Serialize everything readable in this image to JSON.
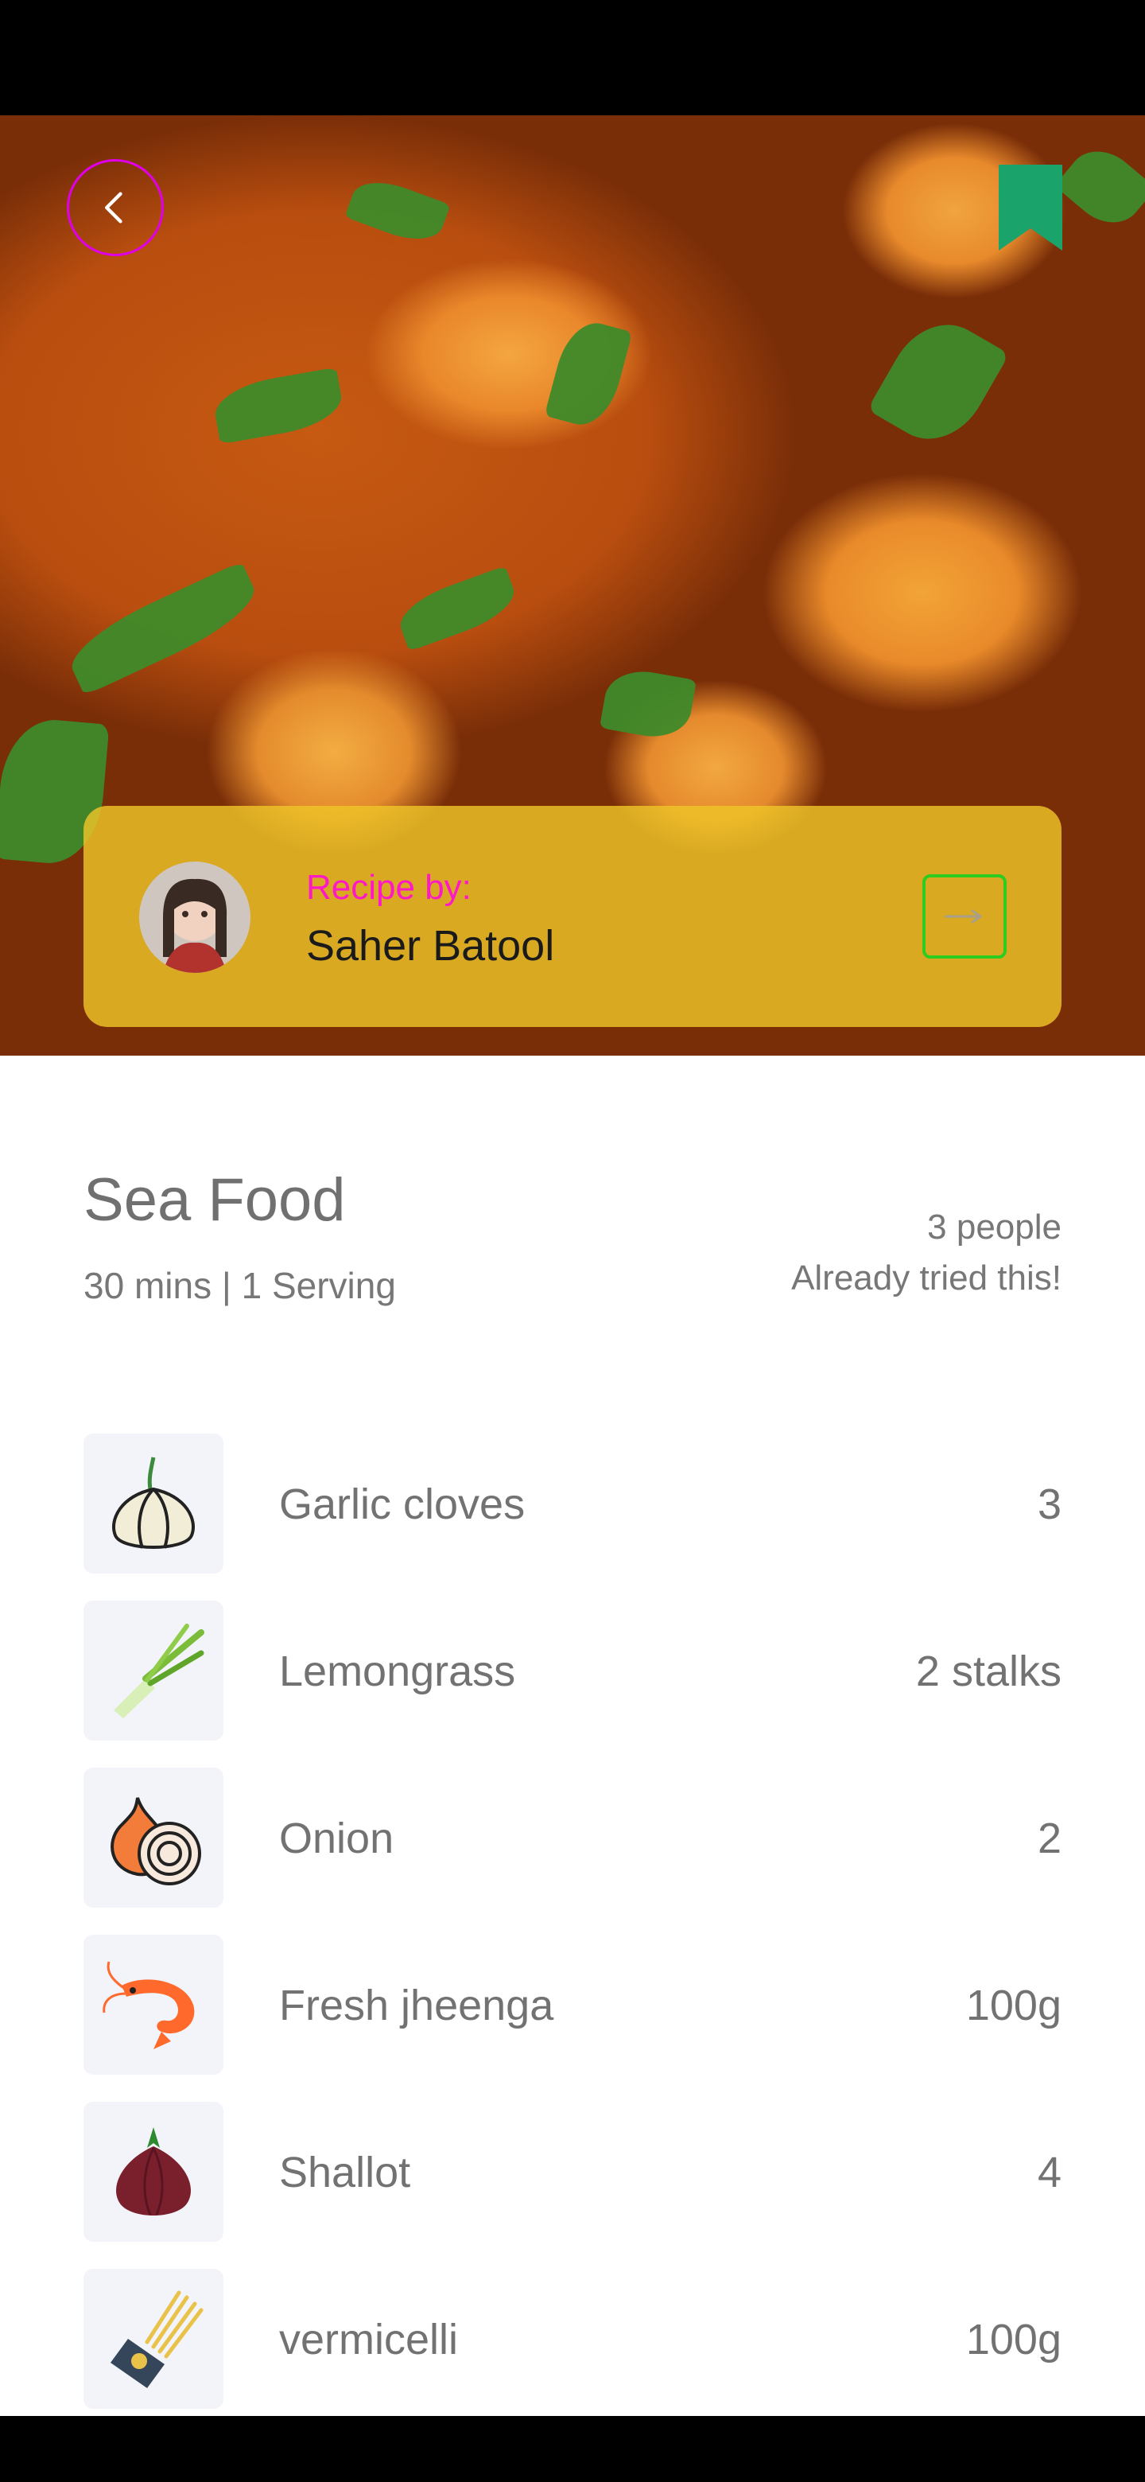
{
  "hero": {
    "image_description_icon": "shrimp-curry-photo"
  },
  "header": {
    "back_icon": "chevron-left-icon",
    "bookmark_icon": "bookmark-icon",
    "bookmark_color": "#1aa36a"
  },
  "author": {
    "label": "Recipe by:",
    "name": "Saher Batool",
    "label_color": "#ff18c8",
    "follow_icon": "arrow-right-icon"
  },
  "recipe": {
    "title": "Sea Food",
    "meta": "30 mins | 1 Serving",
    "tried_count": "3 people",
    "tried_text": "Already tried this!"
  },
  "ingredients": [
    {
      "name": "Garlic cloves",
      "qty": "3",
      "icon": "garlic-icon"
    },
    {
      "name": "Lemongrass",
      "qty": "2 stalks",
      "icon": "lemongrass-icon"
    },
    {
      "name": "Onion",
      "qty": "2",
      "icon": "onion-icon"
    },
    {
      "name": "Fresh jheenga",
      "qty": "100g",
      "icon": "shrimp-icon"
    },
    {
      "name": "Shallot",
      "qty": "4",
      "icon": "shallot-icon"
    },
    {
      "name": "vermicelli",
      "qty": "100g",
      "icon": "vermicelli-icon"
    }
  ]
}
